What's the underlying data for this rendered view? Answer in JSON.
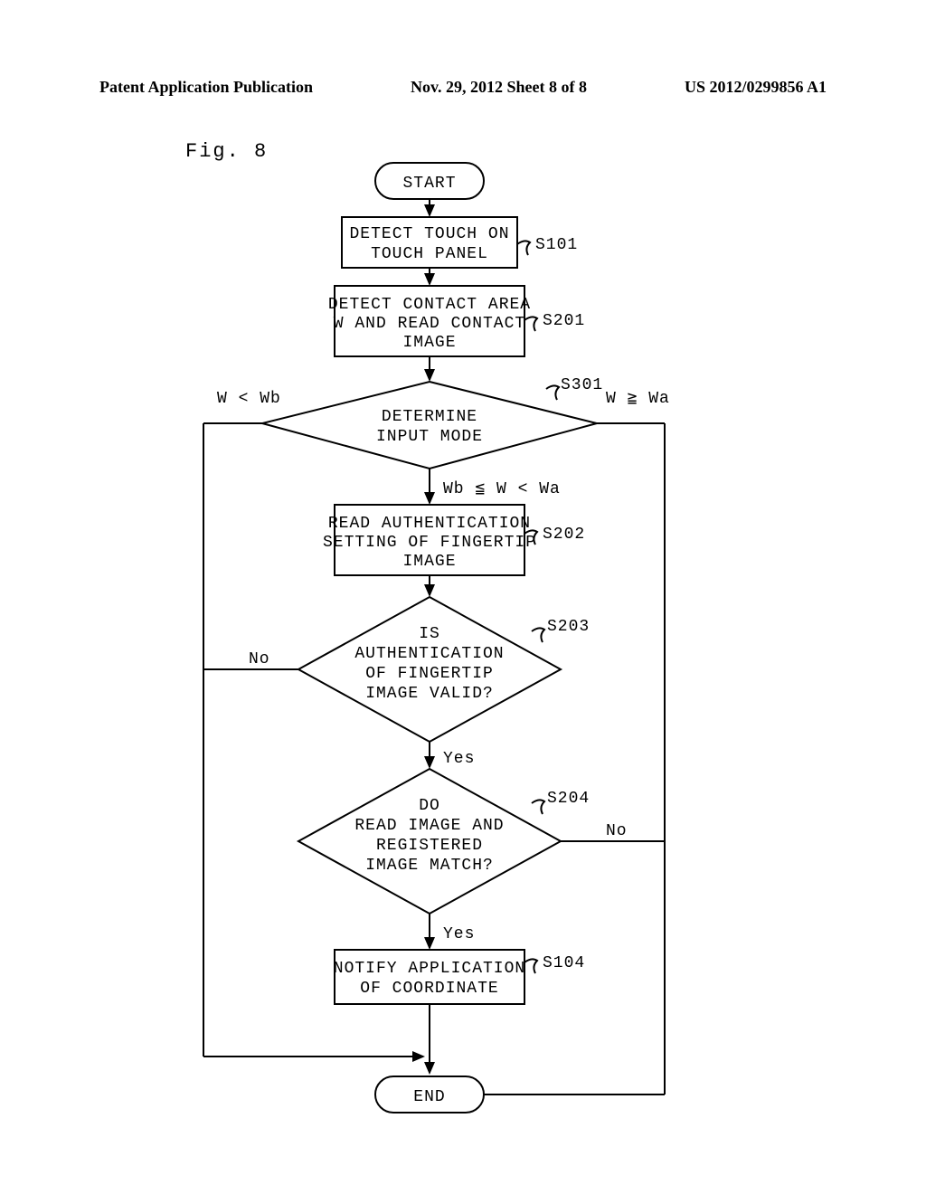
{
  "header": {
    "left": "Patent Application Publication",
    "center": "Nov. 29, 2012  Sheet 8 of 8",
    "right": "US 2012/0299856 A1"
  },
  "figure_label": "Fig. 8",
  "start": "START",
  "end": "END",
  "steps": {
    "s101": {
      "line1": "DETECT TOUCH ON",
      "line2": "TOUCH PANEL",
      "label": "S101"
    },
    "s201": {
      "line1": "DETECT CONTACT AREA",
      "line2": "W AND READ CONTACT",
      "line3": "IMAGE",
      "label": "S201"
    },
    "s301": {
      "line1": "DETERMINE",
      "line2": "INPUT MODE",
      "label": "S301"
    },
    "s202": {
      "line1": "READ AUTHENTICATION",
      "line2": "SETTING OF FINGERTIP",
      "line3": "IMAGE",
      "label": "S202"
    },
    "s203": {
      "line1": "IS",
      "line2": "AUTHENTICATION",
      "line3": "OF FINGERTIP",
      "line4": "IMAGE VALID?",
      "label": "S203"
    },
    "s204": {
      "line1": "DO",
      "line2": "READ IMAGE AND",
      "line3": "REGISTERED",
      "line4": "IMAGE MATCH?",
      "label": "S204"
    },
    "s104": {
      "line1": "NOTIFY APPLICATION",
      "line2": "OF COORDINATE",
      "label": "S104"
    }
  },
  "branch": {
    "left301": "W < Wb",
    "right301": "W ≧ Wa",
    "mid301": "Wb ≦ W < Wa",
    "no": "No",
    "yes": "Yes"
  }
}
